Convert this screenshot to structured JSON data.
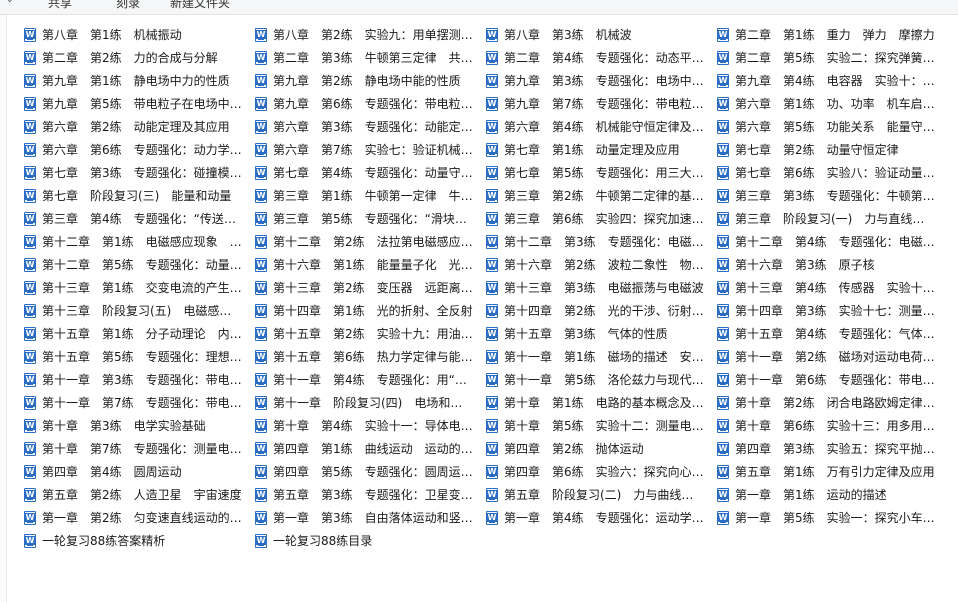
{
  "toolbar": {
    "share_label": "共享",
    "burn_label": "刻录",
    "new_folder_label": "新建文件夹"
  },
  "files": [
    "第八章　第1练　机械振动",
    "第八章　第2练　实验九：用单摆测…",
    "第八章　第3练　机械波",
    "第二章　第1练　重力　弹力　摩擦力",
    "第二章　第2练　力的合成与分解",
    "第二章　第3练　牛顿第三定律　共…",
    "第二章　第4练　专题强化：动态平…",
    "第二章　第5练　实验二：探究弹簧…",
    "第九章　第1练　静电场中力的性质",
    "第九章　第2练　静电场中能的性质",
    "第九章　第3练　专题强化：电场中…",
    "第九章　第4练　电容器　实验十：…",
    "第九章　第5练　带电粒子在电场中…",
    "第九章　第6练　专题强化：带电粒…",
    "第九章　第7练　专题强化：带电粒…",
    "第六章　第1练　功、功率　机车启…",
    "第六章　第2练　动能定理及其应用",
    "第六章　第3练　专题强化：动能定…",
    "第六章　第4练　机械能守恒定律及…",
    "第六章　第5练　功能关系　能量守…",
    "第六章　第6练　专题强化：动力学…",
    "第六章　第7练　实验七：验证机械…",
    "第七章　第1练　动量定理及应用",
    "第七章　第2练　动量守恒定律",
    "第七章　第3练　专题强化：碰撞模…",
    "第七章　第4练　专题强化：动量守…",
    "第七章　第5练　专题强化：用三大…",
    "第七章　第6练　实验八：验证动量…",
    "第七章　阶段复习(三)　能量和动量",
    "第三章　第1练　牛顿第一定律　牛…",
    "第三章　第2练　牛顿第二定律的基…",
    "第三章　第3练　专题强化：牛顿第…",
    "第三章　第4练　专题强化：“传送…",
    "第三章　第5练　专题强化：“滑块…",
    "第三章　第6练　实验四：探究加速…",
    "第三章　阶段复习(一)　力与直线运动",
    "第十二章　第1练　电磁感应现象　…",
    "第十二章　第2练　法拉第电磁感应…",
    "第十二章　第3练　专题强化：电磁…",
    "第十二章　第4练　专题强化：电磁…",
    "第十二章　第5练　专题强化：动量…",
    "第十六章　第1练　能量量子化　光…",
    "第十六章　第2练　波粒二象性　物…",
    "第十六章　第3练　原子核",
    "第十三章　第1练　交变电流的产生…",
    "第十三章　第2练　变压器　远距离…",
    "第十三章　第3练　电磁振荡与电磁波",
    "第十三章　第4练　传感器　实验十…",
    "第十三章　阶段复习(五)　电磁感应…",
    "第十四章　第1练　光的折射、全反射",
    "第十四章　第2练　光的干涉、衍射…",
    "第十四章　第3练　实验十七：测量…",
    "第十五章　第1练　分子动理论　内…",
    "第十五章　第2练　实验十九：用油…",
    "第十五章　第3练　气体的性质",
    "第十五章　第4练　专题强化：气体…",
    "第十五章　第5练　专题强化：理想…",
    "第十五章　第6练　热力学定律与能…",
    "第十一章　第1练　磁场的描述　安…",
    "第十一章　第2练　磁场对运动电荷(…",
    "第十一章　第3练　专题强化：带电…",
    "第十一章　第4练　专题强化：用“…",
    "第十一章　第5练　洛伦兹力与现代…",
    "第十一章　第6练　专题强化：带电…",
    "第十一章　第7练　专题强化：带电…",
    "第十一章　阶段复习(四)　电场和磁场",
    "第十章　第1练　电路的基本概念及…",
    "第十章　第2练　闭合电路欧姆定律…",
    "第十章　第3练　电学实验基础",
    "第十章　第4练　实验十一：导体电…",
    "第十章　第5练　实验十二：测量电…",
    "第十章　第6练　实验十三：用多用…",
    "第十章　第7练　专题强化：测量电…",
    "第四章　第1练　曲线运动　运动的…",
    "第四章　第2练　抛体运动",
    "第四章　第3练　实验五：探究平抛…",
    "第四章　第4练　圆周运动",
    "第四章　第5练　专题强化：圆周运…",
    "第四章　第6练　实验六：探究向心…",
    "第五章　第1练　万有引力定律及应用",
    "第五章　第2练　人造卫星　宇宙速度",
    "第五章　第3练　专题强化：卫星变…",
    "第五章　阶段复习(二)　力与曲线运动",
    "第一章　第1练　运动的描述",
    "第一章　第2练　匀变速直线运动的…",
    "第一章　第3练　自由落体运动和竖…",
    "第一章　第4练　专题强化：运动学…",
    "第一章　第5练　实验一：探究小车…",
    "一轮复习88练答案精析",
    "一轮复习88练目录"
  ]
}
